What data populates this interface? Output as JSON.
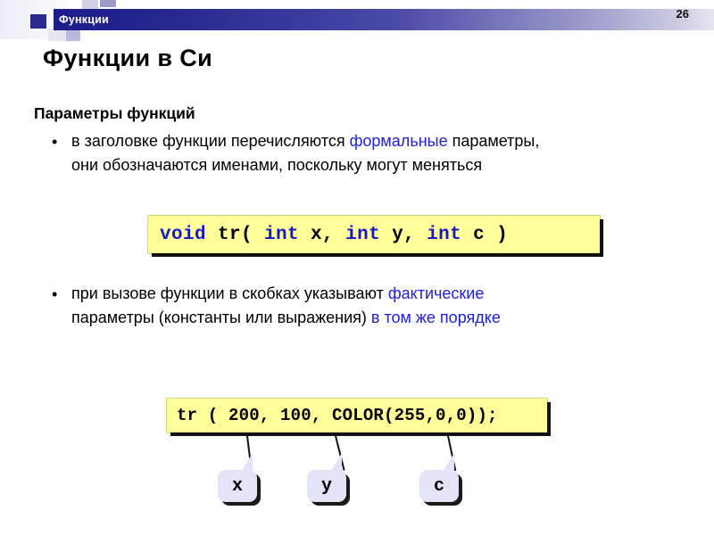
{
  "header": {
    "title": "Функции",
    "page_number": "26",
    "bar_color_start": "#1c1c8c",
    "bar_color_end": "#e6e6f2"
  },
  "slide": {
    "title": "Функции в Си",
    "subtitle": "Параметры функций",
    "bullet_marker": "•",
    "bullets": [
      {
        "id": "bullet-1",
        "line1_pre": "в заголовке функции перечисляются ",
        "line1_hl": "формальные",
        "line1_post": " параметры,",
        "line2_pre": "они обозначаются именами, поскольку могут меняться",
        "line2_hl": "",
        "line2_post": ""
      },
      {
        "id": "bullet-2",
        "line1_pre": "при вызове функции в скобках указывают ",
        "line1_hl": "фактические",
        "line1_post": "",
        "line2_pre": "параметры (константы или выражения) ",
        "line2_hl": "в том же порядке",
        "line2_post": ""
      }
    ],
    "highlight_color": "#2020e0"
  },
  "code_box_1": {
    "background": "#ffff99",
    "keyword_color": "#1818c8",
    "tokens": [
      {
        "text": "void",
        "kind": "keyword"
      },
      {
        "text": " tr( ",
        "kind": "plain"
      },
      {
        "text": "int",
        "kind": "keyword"
      },
      {
        "text": " x, ",
        "kind": "plain"
      },
      {
        "text": "int",
        "kind": "keyword"
      },
      {
        "text": " y, ",
        "kind": "plain"
      },
      {
        "text": "int",
        "kind": "keyword"
      },
      {
        "text": " c )",
        "kind": "plain"
      }
    ],
    "full_text": "void tr( int x, int y, int c )"
  },
  "code_box_2": {
    "background": "#ffff99",
    "full_text": "tr ( 200, 100, COLOR(255,0,0));"
  },
  "callouts": [
    {
      "id": "callout-x",
      "label": "x"
    },
    {
      "id": "callout-y",
      "label": "y"
    },
    {
      "id": "callout-c",
      "label": "c"
    }
  ]
}
